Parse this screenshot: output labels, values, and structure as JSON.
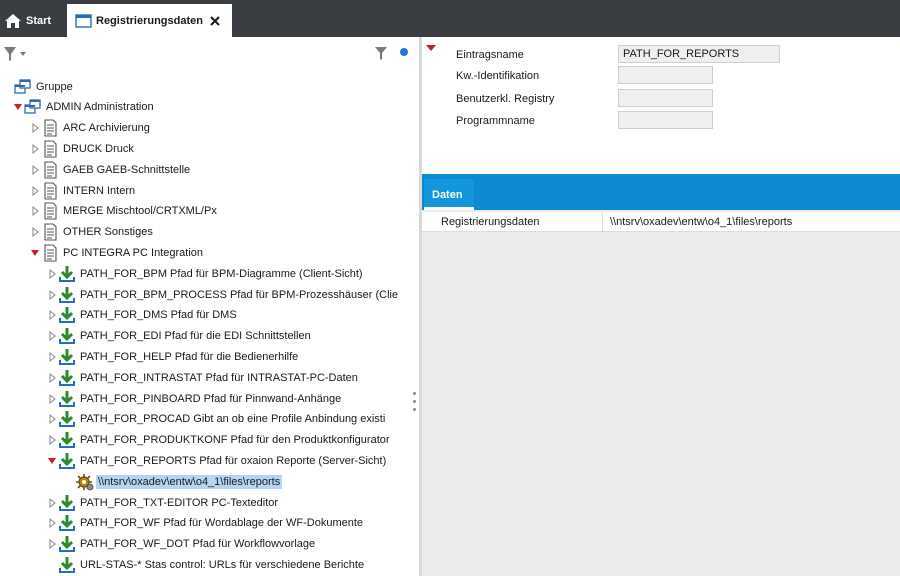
{
  "tabs": {
    "start_label": "Start",
    "registry_label": "Registrierungsdaten"
  },
  "tree": {
    "items": [
      {
        "label": "Gruppe",
        "icon": "group-icon",
        "expand": "none"
      },
      {
        "label": "ADMIN  Administration",
        "icon": "group-icon",
        "expand": "expanded"
      },
      {
        "label": "ARC  Archivierung",
        "icon": "document-icon",
        "expand": "collapsed"
      },
      {
        "label": "DRUCK  Druck",
        "icon": "document-icon",
        "expand": "collapsed"
      },
      {
        "label": "GAEB  GAEB-Schnittstelle",
        "icon": "document-icon",
        "expand": "collapsed"
      },
      {
        "label": "INTERN  Intern",
        "icon": "document-icon",
        "expand": "collapsed"
      },
      {
        "label": "MERGE  Mischtool/CRTXML/Px",
        "icon": "document-icon",
        "expand": "collapsed"
      },
      {
        "label": "OTHER  Sonstiges",
        "icon": "document-icon",
        "expand": "collapsed"
      },
      {
        "label": "PC INTEGRA  PC Integration",
        "icon": "document-icon",
        "expand": "expanded"
      },
      {
        "label": "PATH_FOR_BPM  Pfad für BPM-Diagramme (Client-Sicht)",
        "icon": "download-icon",
        "expand": "collapsed"
      },
      {
        "label": "PATH_FOR_BPM_PROCESS  Pfad für BPM-Prozesshäuser (Clie",
        "icon": "download-icon",
        "expand": "collapsed"
      },
      {
        "label": "PATH_FOR_DMS  Pfad für DMS",
        "icon": "download-icon",
        "expand": "collapsed"
      },
      {
        "label": "PATH_FOR_EDI  Pfad für die EDI Schnittstellen",
        "icon": "download-icon",
        "expand": "collapsed"
      },
      {
        "label": "PATH_FOR_HELP  Pfad für die Bedienerhilfe",
        "icon": "download-icon",
        "expand": "collapsed"
      },
      {
        "label": "PATH_FOR_INTRASTAT  Pfad für INTRASTAT-PC-Daten",
        "icon": "download-icon",
        "expand": "collapsed"
      },
      {
        "label": "PATH_FOR_PINBOARD  Pfad für Pinnwand-Anhänge",
        "icon": "download-icon",
        "expand": "collapsed"
      },
      {
        "label": "PATH_FOR_PROCAD  Gibt an ob eine Profile Anbindung existi",
        "icon": "download-icon",
        "expand": "collapsed"
      },
      {
        "label": "PATH_FOR_PRODUKTKONF  Pfad für den Produktkonfigurator",
        "icon": "download-icon",
        "expand": "collapsed"
      },
      {
        "label": "PATH_FOR_REPORTS  Pfad für oxaion Reporte (Server-Sicht)",
        "icon": "download-icon",
        "expand": "expanded"
      },
      {
        "label": "\\\\ntsrv\\oxadev\\entw\\o4_1\\files\\reports",
        "icon": "gear-icon",
        "expand": "none",
        "selected": true
      },
      {
        "label": "PATH_FOR_TXT-EDITOR  PC-Texteditor",
        "icon": "download-icon",
        "expand": "collapsed"
      },
      {
        "label": "PATH_FOR_WF  Pfad für Wordablage der WF-Dokumente",
        "icon": "download-icon",
        "expand": "collapsed"
      },
      {
        "label": "PATH_FOR_WF_DOT  Pfad für Workflowvorlage",
        "icon": "download-icon",
        "expand": "collapsed"
      },
      {
        "label": "URL-STAS-*  Stas control: URLs für verschiedene Berichte",
        "icon": "download-icon",
        "expand": "none"
      }
    ]
  },
  "form": {
    "fields": [
      {
        "label": "Eintragsname",
        "value": "PATH_FOR_REPORTS"
      },
      {
        "label": "Kw.-Identifikation",
        "value": ""
      },
      {
        "label": "Benutzerkl. Registry",
        "value": ""
      },
      {
        "label": "Programmname",
        "value": ""
      }
    ]
  },
  "detail": {
    "tab_label": "Daten",
    "row_label": "Registrierungsdaten",
    "row_value": "\\\\ntsrv\\oxadev\\entw\\o4_1\\files\\reports"
  },
  "colors": {
    "topbar": "#3a3d41",
    "accent_blue": "#0c8ad3",
    "tree_selection": "#b5d5f1",
    "expand_red": "#cc1f1f",
    "icon_green": "#3a9a3a"
  }
}
